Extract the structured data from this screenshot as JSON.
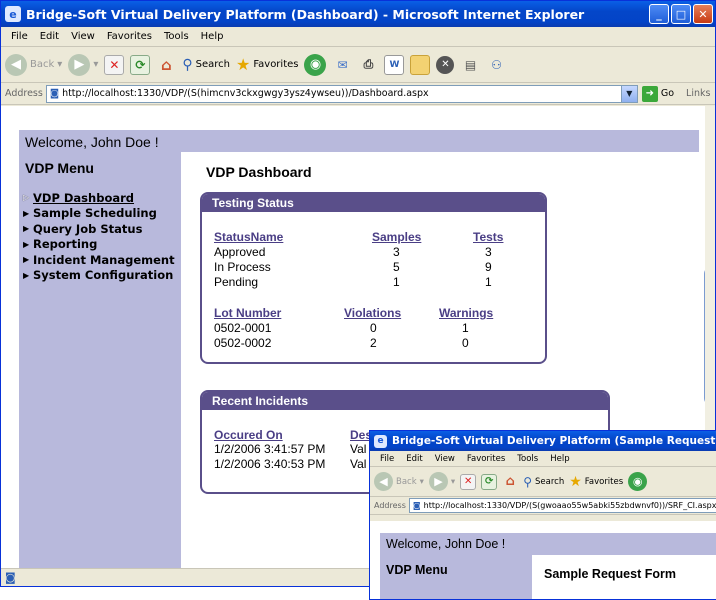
{
  "window": {
    "title": "Bridge-Soft Virtual Delivery Platform (Dashboard) - Microsoft Internet Explorer",
    "menu": [
      "File",
      "Edit",
      "View",
      "Favorites",
      "Tools",
      "Help"
    ],
    "toolbar": {
      "back": "Back",
      "search": "Search",
      "favorites": "Favorites"
    },
    "address_label": "Address",
    "address": "http://localhost:1330/VDP/(S(himcnv3ckxgwgy3ysz4ywseu))/Dashboard.aspx",
    "go_label": "Go",
    "links_label": "Links"
  },
  "page": {
    "welcome": "Welcome, John Doe !",
    "menu_title": "VDP Menu",
    "menu_items": [
      {
        "label": "VDP Dashboard"
      },
      {
        "label": "Sample Scheduling"
      },
      {
        "label": "Query Job Status"
      },
      {
        "label": "Reporting"
      },
      {
        "label": "Incident Management"
      },
      {
        "label": "System Configuration"
      }
    ],
    "dashboard_title": "VDP Dashboard",
    "testing_status": {
      "title": "Testing Status",
      "headers": [
        "StatusName",
        "Samples",
        "Tests"
      ],
      "rows": [
        [
          "Approved",
          "3",
          "3"
        ],
        [
          "In Process",
          "5",
          "9"
        ],
        [
          "Pending",
          "1",
          "1"
        ]
      ],
      "lot_headers": [
        "Lot Number",
        "Violations",
        "Warnings"
      ],
      "lot_rows": [
        [
          "0502-0001",
          "0",
          "1"
        ],
        [
          "0502-0002",
          "2",
          "0"
        ]
      ]
    },
    "recent_incidents": {
      "title": "Recent Incidents",
      "headers": [
        "Occured On",
        "Des"
      ],
      "rows": [
        [
          "1/2/2006 3:41:57 PM",
          "Val"
        ],
        [
          "1/2/2006 3:40:53 PM",
          "Val"
        ]
      ]
    }
  },
  "window2": {
    "title": "Bridge-Soft Virtual Delivery Platform (Sample Request Form) - Micr",
    "menu": [
      "File",
      "Edit",
      "View",
      "Favorites",
      "Tools",
      "Help"
    ],
    "toolbar": {
      "back": "Back",
      "search": "Search",
      "favorites": "Favorites"
    },
    "address_label": "Address",
    "address": "http://localhost:1330/VDP/(S(gwoaao55w5abki55zbdwnvf0))/SRF_CI.aspx",
    "welcome": "Welcome, John Doe !",
    "menu_title": "VDP Menu",
    "form_title": "Sample Request Form"
  }
}
